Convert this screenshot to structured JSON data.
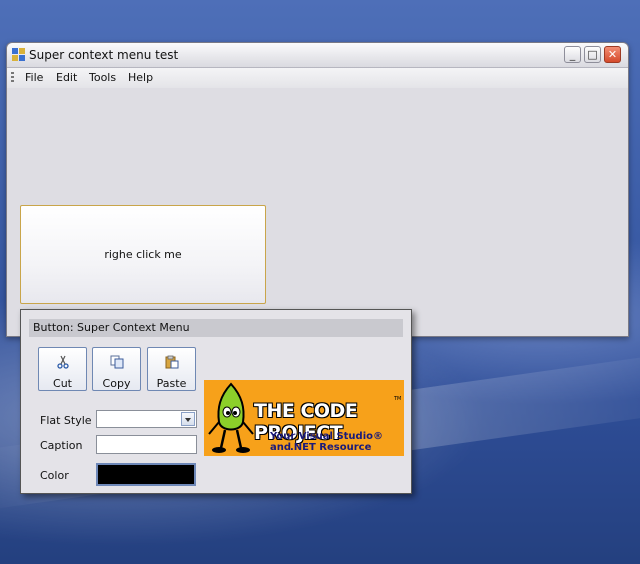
{
  "window": {
    "title": "Super context menu test",
    "controls": {
      "minimize": "_",
      "maximize": "□",
      "close": "✕"
    }
  },
  "menubar": {
    "items": [
      "File",
      "Edit",
      "Tools",
      "Help"
    ]
  },
  "main_button": {
    "label": "righe click me"
  },
  "popup": {
    "header": "Button: Super Context Menu",
    "tools": [
      {
        "label": "Cut",
        "icon": "scissors-icon"
      },
      {
        "label": "Copy",
        "icon": "copy-icon"
      },
      {
        "label": "Paste",
        "icon": "paste-icon"
      }
    ],
    "fields": {
      "flat_style_label": "Flat Style",
      "flat_style_value": "",
      "caption_label": "Caption",
      "caption_value": "",
      "color_label": "Color",
      "color_value": "#000000"
    },
    "logo": {
      "title": "THE CODE PROJECT",
      "trademark": "TM",
      "tagline_line1": "Your Visual Studio® and",
      "tagline_line2": ".NET Resource",
      "background": "#f7a11a"
    }
  },
  "colors": {
    "desktop": "#3b5ca6",
    "window_bg": "#dedde3",
    "button_border": "#c9a54a"
  }
}
